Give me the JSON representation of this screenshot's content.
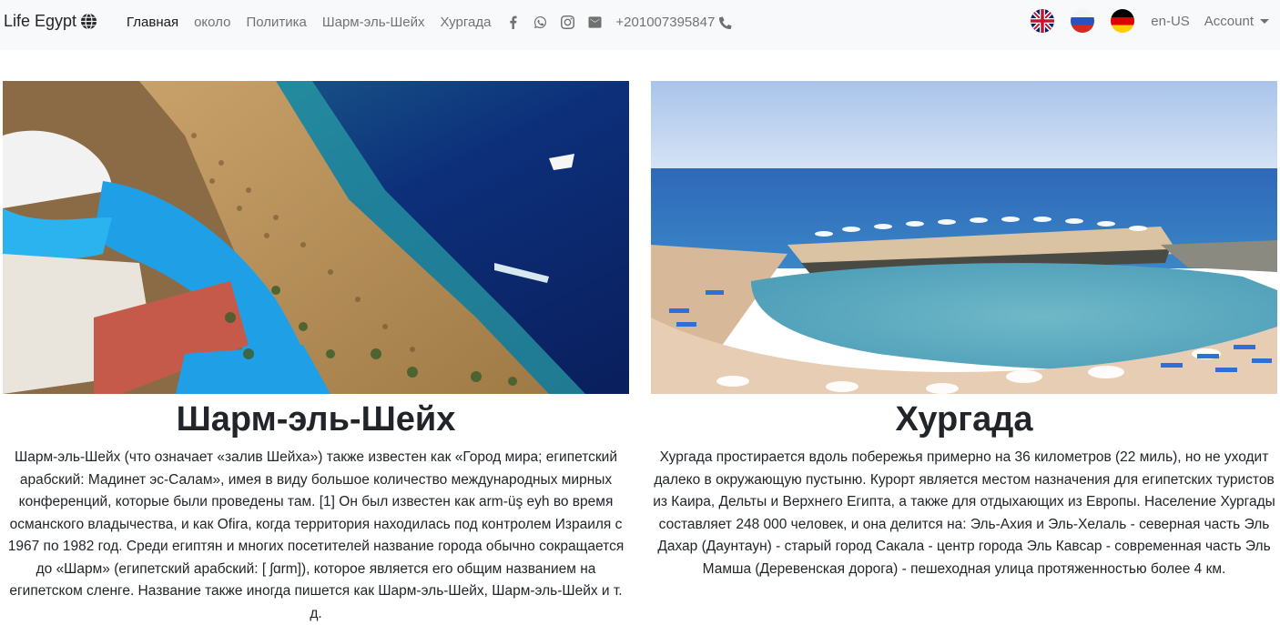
{
  "brand": {
    "name": "Life Egypt",
    "icon": "globe-icon"
  },
  "nav": {
    "home": "Главная",
    "about": "около",
    "policy": "Политика",
    "sharm": "Шарм-эль-Шейх",
    "hurghada": "Хургада",
    "phone": "+201007395847"
  },
  "social_icons": [
    "facebook-icon",
    "whatsapp-icon",
    "instagram-icon",
    "envelope-icon"
  ],
  "languages": [
    "uk-flag",
    "russia-flag",
    "germany-flag"
  ],
  "locale": "en-US",
  "account": "Account",
  "cards": {
    "sharm": {
      "title": "Шарм-эль-Шейх",
      "text": "Шарм-эль-Шейх (что означает «залив Шейха») также известен как «Город мира; египетский арабский: Мадинет эс-Салам», имея в виду большое количество международных мирных конференций, которые были проведены там. [1] Он был известен как arm-üş eyh во время османского владычества, и как Ofira, когда территория находилась под контролем Израиля с 1967 по 1982 год. Среди египтян и многих посетителей название города обычно сокращается до «Шарм» (египетский арабский: [ ʃɑrm]), которое является его общим названием на египетском сленге. Название также иногда пишется как Шарм-эль-Шейх, Шарм-эль-Шейх и т. д."
    },
    "hurghada": {
      "title": "Хургада",
      "text": "Хургада простирается вдоль побережья примерно на 36 километров (22 миль), но не уходит далеко в окружающую пустыню. Курорт является местом назначения для египетских туристов из Каира, Дельты и Верхнего Египта, а также для отдыхающих из Европы. Население Хургады составляет 248 000 человек, и она делится на: Эль-Ахия и Эль-Хелаль - северная часть Эль Дахар (Даунтаун) - старый город Сакала - центр города Эль Кавсар - современная часть Эль Мамша (Деревенская дорога) - пешеходная улица протяженностью более 4 км."
    }
  },
  "colors": {
    "navbar_bg": "#f8f9fa",
    "text": "#212529",
    "muted": "rgba(0,0,0,0.55)"
  }
}
